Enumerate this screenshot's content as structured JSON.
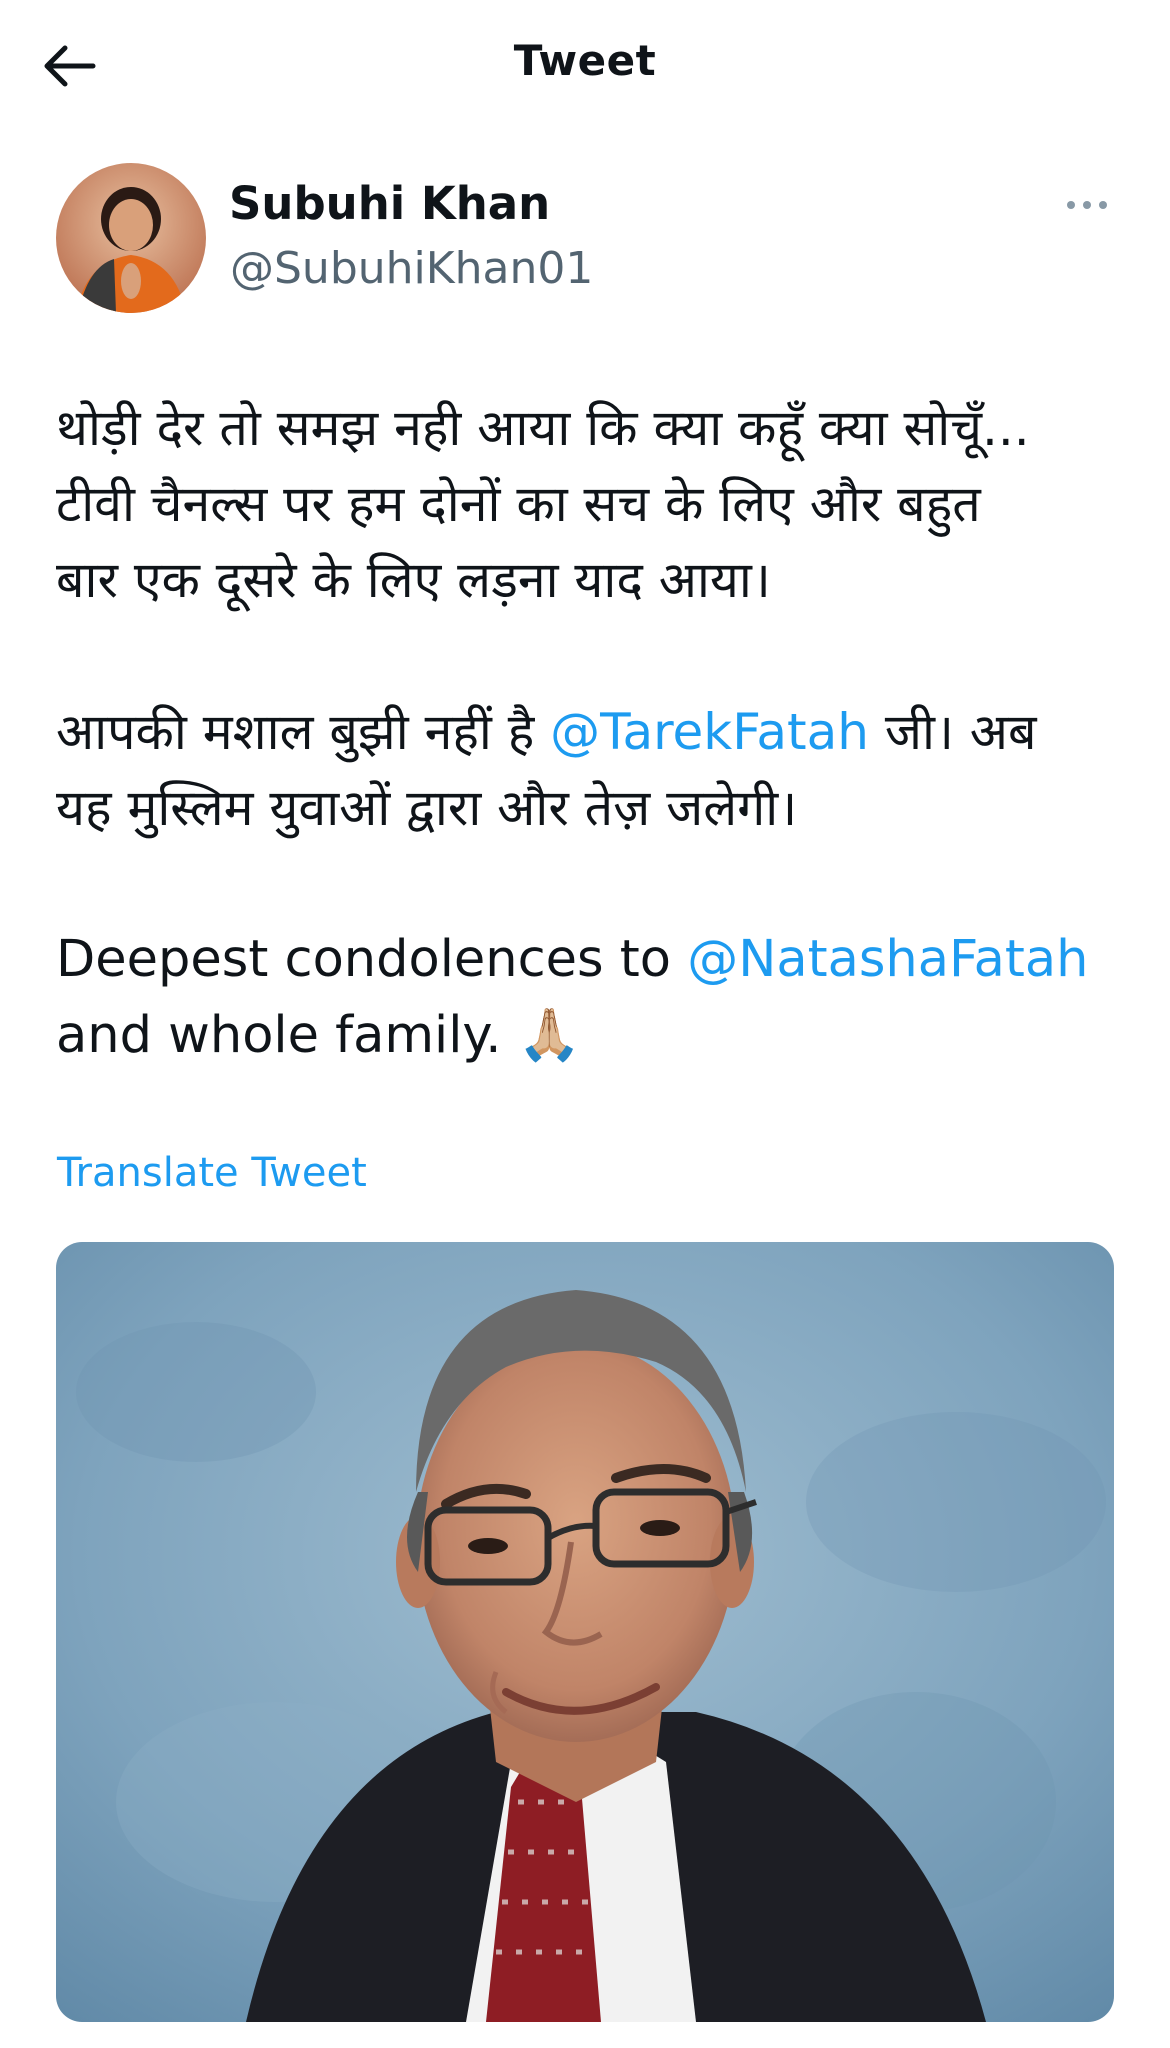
{
  "header": {
    "title": "Tweet",
    "back_icon": "arrow-left-icon"
  },
  "author": {
    "display_name": "Subuhi Khan",
    "handle": "@SubuhiKhan01",
    "avatar_icon": "profile-photo",
    "more_icon": "more-horizontal-icon"
  },
  "tweet": {
    "paragraph1": {
      "line1": "थोड़ी देर तो समझ नही आया कि क्या कहूँ क्या सोचूँ...",
      "line2": "टीवी चैनल्स पर हम दोनों का सच के लिए और बहुत",
      "line3": "बार एक दूसरे के लिए लड़ना याद आया।"
    },
    "paragraph2": {
      "line1_before": "आपकी मशाल बुझी नहीं है ",
      "mention": "@TarekFatah",
      "line1_after": " जी। अब",
      "line2": "यह मुस्लिम युवाओं द्वारा और तेज़ जलेगी।"
    },
    "paragraph3": {
      "line1_before": "Deepest condolences to ",
      "mention": "@NatashaFatah",
      "line2_text": "and whole family. ",
      "emoji": "🙏🏼"
    }
  },
  "translate_label": "Translate Tweet",
  "media": {
    "description_icon": "photo-of-man-icon"
  },
  "colors": {
    "link": "#1d9bf0",
    "text": "#0f1419",
    "secondary": "#536471",
    "photo_bg": "#7ea3bd"
  }
}
